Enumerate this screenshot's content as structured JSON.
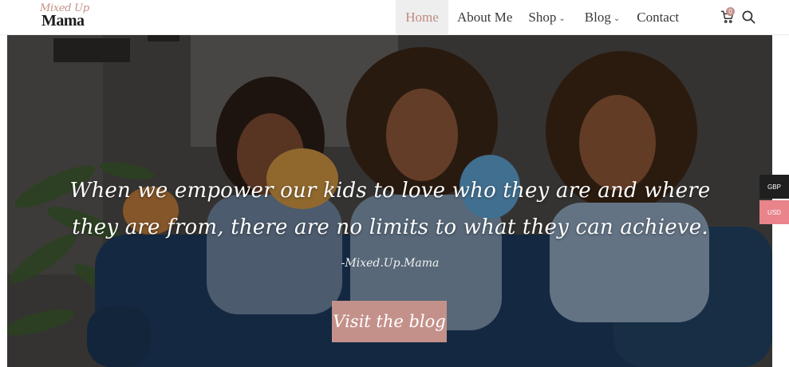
{
  "header": {
    "logo_script": "Mixed Up",
    "logo_main": "Mama",
    "nav": {
      "home": "Home",
      "about": "About Me",
      "shop": "Shop",
      "blog": "Blog",
      "contact": "Contact"
    },
    "cart_count": "0"
  },
  "hero": {
    "quote": "When we empower our kids to love who they are and where they are from, there are no limits to what they can achieve.",
    "author": "-Mixed.Up.Mama",
    "cta_label": "Visit the blog"
  },
  "currency": {
    "options": [
      "GBP",
      "USD"
    ],
    "selected": "USD"
  },
  "colors": {
    "accent": "#c4918a",
    "currency_active": "#e8848a",
    "currency_inactive": "#1f1f1f"
  }
}
